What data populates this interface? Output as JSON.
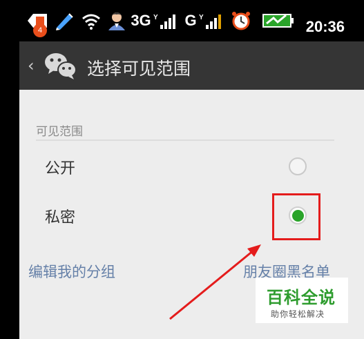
{
  "status_bar": {
    "notification_count": "4",
    "network_3g": "3G",
    "network_g": "G",
    "time": "20:36"
  },
  "header": {
    "title": "选择可见范围"
  },
  "section": {
    "label": "可见范围"
  },
  "options": [
    {
      "label": "公开",
      "selected": false
    },
    {
      "label": "私密",
      "selected": true
    }
  ],
  "links": {
    "edit_groups": "编辑我的分组",
    "moments_blacklist": "朋友圈黑名单"
  },
  "watermark": {
    "title": "百科全说",
    "subtitle": "助你轻松解决"
  },
  "colors": {
    "radio_selected": "#2aa42a",
    "highlight": "#e41c1c",
    "link": "#6580a8",
    "title_bar": "#353535"
  }
}
